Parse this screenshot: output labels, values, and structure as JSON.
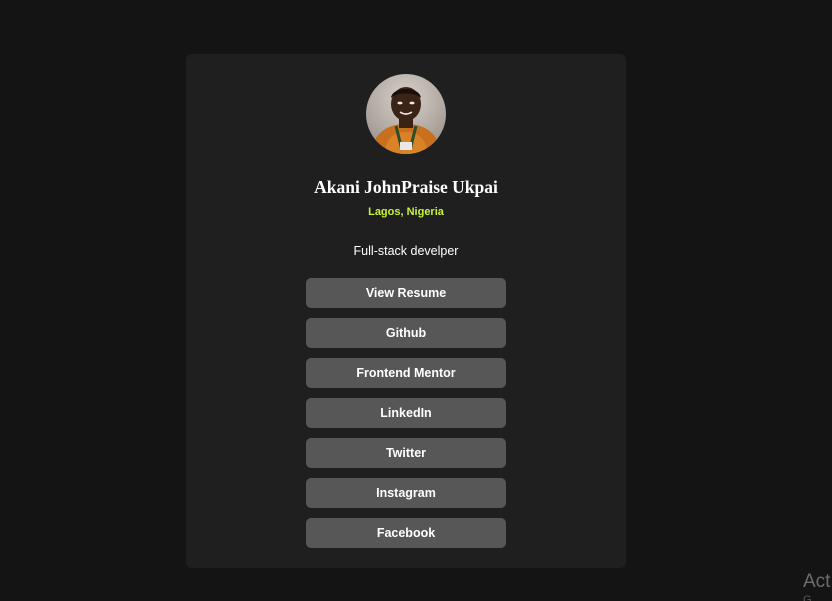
{
  "profile": {
    "name": "Akani JohnPraise Ukpai",
    "location": "Lagos, Nigeria",
    "bio": "Full-stack develper",
    "avatar_alt": "profile photo"
  },
  "links": [
    {
      "label": "View Resume"
    },
    {
      "label": "Github"
    },
    {
      "label": "Frontend Mentor"
    },
    {
      "label": "LinkedIn"
    },
    {
      "label": "Twitter"
    },
    {
      "label": "Instagram"
    },
    {
      "label": "Facebook"
    }
  ],
  "watermark": {
    "line1": "Act",
    "line2": "G"
  },
  "colors": {
    "background": "#141414",
    "card": "#1f1f1f",
    "button": "#575757",
    "accent": "#c6f23e",
    "text": "#ffffff"
  }
}
